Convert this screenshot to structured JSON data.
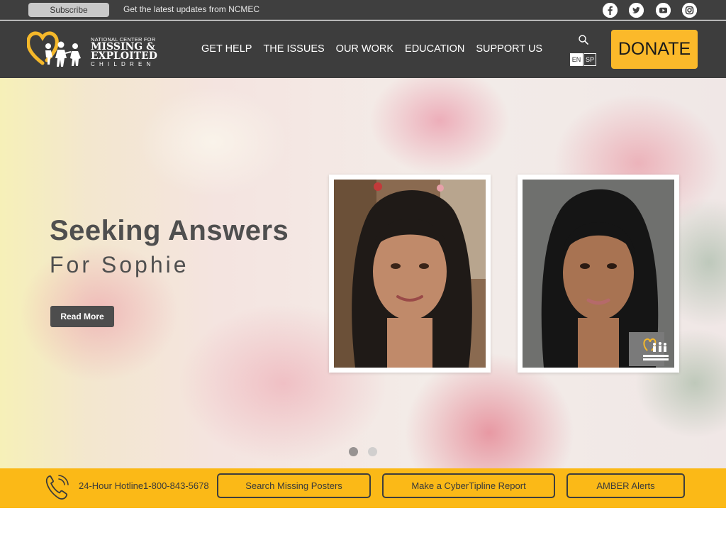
{
  "topbar": {
    "subscribe_label": "Subscribe",
    "message": "Get the latest updates from NCMEC",
    "social_icons": [
      "facebook-icon",
      "twitter-icon",
      "youtube-icon",
      "instagram-icon"
    ]
  },
  "header": {
    "logo": {
      "line1": "NATIONAL CENTER FOR",
      "line2": "MISSING &",
      "line3": "EXPLOITED",
      "line4": "CHILDREN"
    },
    "nav": [
      "GET HELP",
      "THE ISSUES",
      "OUR WORK",
      "EDUCATION",
      "SUPPORT US"
    ],
    "languages": [
      "EN",
      "SP"
    ],
    "donate_label": "DONATE"
  },
  "hero": {
    "title": "Seeking Answers",
    "subtitle": "For Sophie",
    "cta_label": "Read More",
    "slides": 2,
    "active_slide": 1
  },
  "actionbar": {
    "hotline_label": "24-Hour Hotline",
    "hotline_number": "1-800-843-5678",
    "buttons": [
      "Search Missing Posters",
      "Make a CyberTipline Report",
      "AMBER Alerts"
    ]
  },
  "colors": {
    "topbar_bg": "#3f3f3f",
    "header_bg": "#3d3d3d",
    "accent_yellow": "#fbb917",
    "donate_yellow": "#fbb92a",
    "hero_text": "#4f4f4f"
  }
}
